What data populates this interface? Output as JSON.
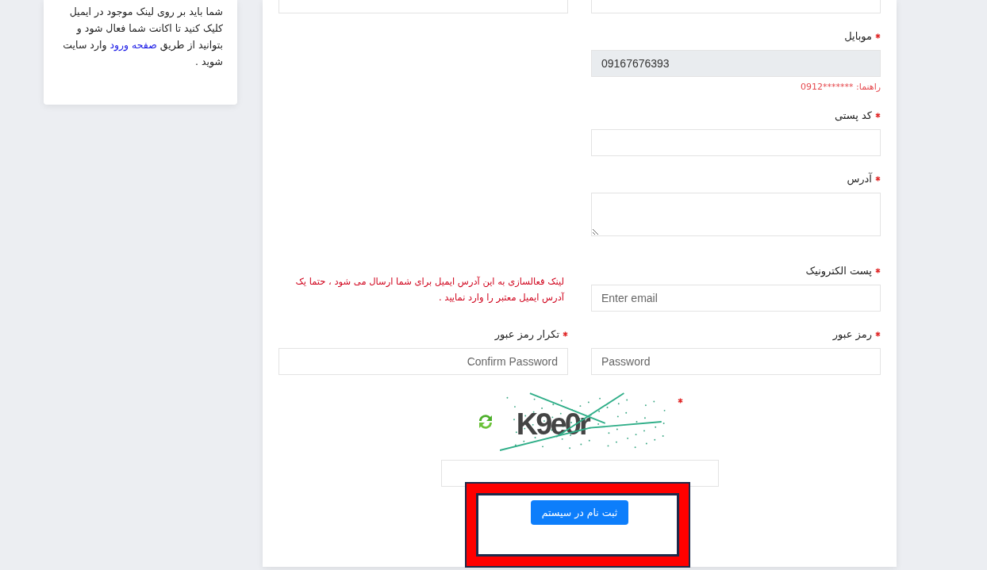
{
  "info_card": {
    "text_before": "شما باید بر روی لینک موجود در ایمیل کلیک کنید تا اکانت شما فعال شود و بتوانید از طریق",
    "link": "صفحه ورود",
    "text_after": "وارد سایت شوید ."
  },
  "form": {
    "rows": [
      {
        "right": {
          "kind": "input",
          "label": "موبایل",
          "required": true,
          "value": "09167676393",
          "disabled": true,
          "hint": "راهنما: *******0912"
        }
      },
      {
        "right": {
          "kind": "input",
          "label": "کد پستی",
          "required": true,
          "disabled": false
        }
      },
      {
        "right": {
          "kind": "textarea",
          "label": "آدرس",
          "required": true,
          "disabled": false
        }
      },
      {
        "right": {
          "kind": "input",
          "label": "پست الکترونیک",
          "required": true,
          "placeholder": "Enter email",
          "disabled": false
        },
        "left": {
          "kind": "note",
          "text": "لینک فعالسازی به این آدرس ایمیل برای شما ارسال می شود ، حتما یک آدرس ایمیل معتبر را وارد نمایید ."
        }
      },
      {
        "right": {
          "kind": "input",
          "label": "رمز عبور",
          "required": true,
          "placeholder": "Password",
          "disabled": false
        },
        "left": {
          "kind": "input",
          "label": "تکرار رمز عبور",
          "required": true,
          "placeholder": "Confirm Password",
          "disabled": false
        }
      }
    ],
    "captcha": {
      "code": "K9e0r",
      "required": true
    },
    "submit": "ثبت نام در سیستم"
  }
}
